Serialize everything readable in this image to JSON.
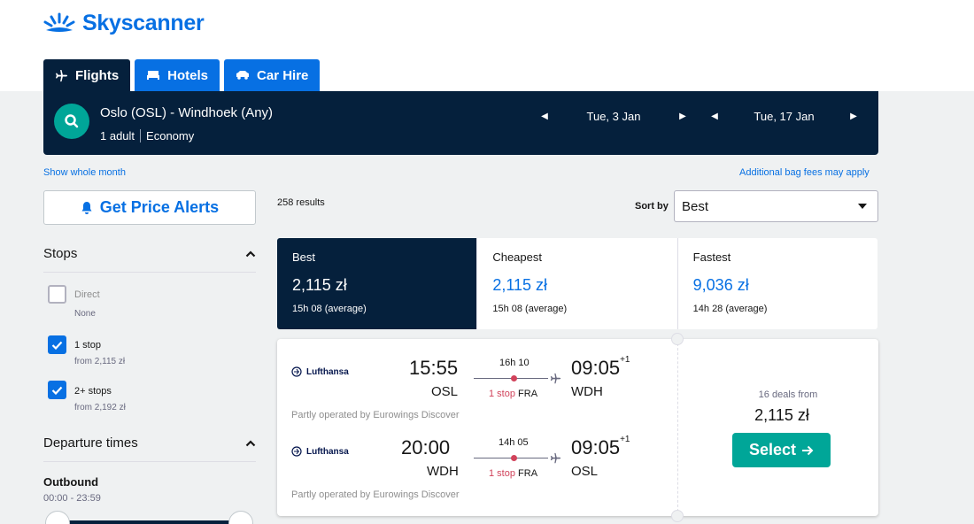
{
  "brand": {
    "name": "Skyscanner",
    "color": "#0770e3"
  },
  "tabs": [
    {
      "label": "Flights",
      "icon": "plane-icon",
      "active": true
    },
    {
      "label": "Hotels",
      "icon": "bed-icon",
      "active": false
    },
    {
      "label": "Car Hire",
      "icon": "car-icon",
      "active": false
    }
  ],
  "search": {
    "route": "Oslo (OSL) - Windhoek (Any)",
    "passengers": "1 adult",
    "cabin": "Economy",
    "depart_date": "Tue, 3 Jan",
    "return_date": "Tue, 17 Jan"
  },
  "links": {
    "show_month": "Show whole month",
    "bag_fees": "Additional bag fees may apply"
  },
  "price_alerts": {
    "label": "Get Price Alerts",
    "icon": "bell-icon"
  },
  "filters": {
    "stops": {
      "title": "Stops",
      "options": [
        {
          "label": "Direct",
          "sub": "None",
          "checked": false
        },
        {
          "label": "1 stop",
          "sub": "from 2,115 zł",
          "checked": true
        },
        {
          "label": "2+ stops",
          "sub": "from 2,192 zł",
          "checked": true
        }
      ]
    },
    "departure": {
      "title": "Departure times",
      "outbound_label": "Outbound",
      "outbound_range": "00:00 - 23:59"
    }
  },
  "results": {
    "count": "258 results",
    "sort_label": "Sort by",
    "sort_value": "Best"
  },
  "sort_tabs": [
    {
      "label": "Best",
      "price": "2,115 zł",
      "duration": "15h 08 (average)",
      "active": true
    },
    {
      "label": "Cheapest",
      "price": "2,115 zł",
      "duration": "15h 08 (average)",
      "active": false
    },
    {
      "label": "Fastest",
      "price": "9,036 zł",
      "duration": "14h 28 (average)",
      "active": false
    }
  ],
  "result_card": {
    "outbound": {
      "airline": "Lufthansa",
      "depart_time": "15:55",
      "depart_airport": "OSL",
      "duration": "16h 10",
      "stops": "1 stop",
      "via": "FRA",
      "arrive_time": "09:05",
      "day_offset": "+1",
      "arrive_airport": "WDH",
      "note": "Partly operated by Eurowings Discover"
    },
    "inbound": {
      "airline": "Lufthansa",
      "depart_time": "20:00",
      "depart_airport": "WDH",
      "duration": "14h 05",
      "stops": "1 stop",
      "via": "FRA",
      "arrive_time": "09:05",
      "day_offset": "+1",
      "arrive_airport": "OSL",
      "note": "Partly operated by Eurowings Discover"
    },
    "deals": "16 deals from",
    "price": "2,115 zł",
    "select_label": "Select"
  }
}
